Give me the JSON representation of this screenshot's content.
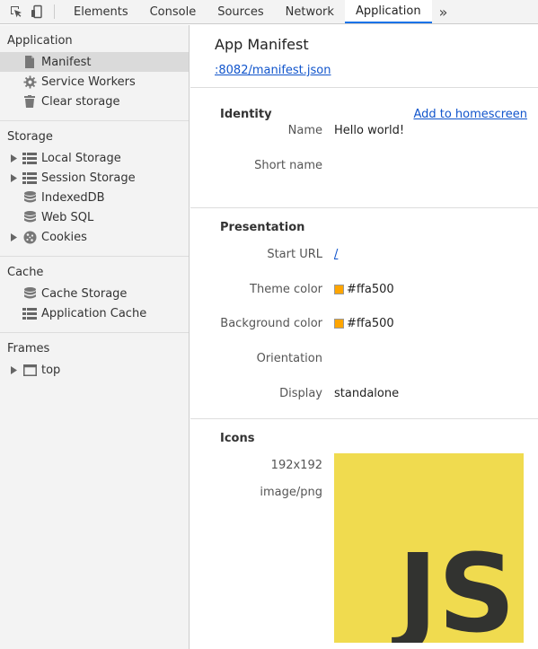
{
  "toolbar": {
    "tabs": [
      {
        "label": "Elements"
      },
      {
        "label": "Console"
      },
      {
        "label": "Sources"
      },
      {
        "label": "Network"
      },
      {
        "label": "Application",
        "active": true
      }
    ],
    "more_label": "»",
    "accent": "#1a73e8"
  },
  "sidebar": {
    "sections": [
      {
        "title": "Application",
        "items": [
          {
            "label": "Manifest",
            "icon": "document-icon",
            "selected": true
          },
          {
            "label": "Service Workers",
            "icon": "gear-icon"
          },
          {
            "label": "Clear storage",
            "icon": "trash-icon"
          }
        ]
      },
      {
        "title": "Storage",
        "items": [
          {
            "label": "Local Storage",
            "icon": "grid-icon",
            "expandable": true
          },
          {
            "label": "Session Storage",
            "icon": "grid-icon",
            "expandable": true
          },
          {
            "label": "IndexedDB",
            "icon": "database-icon"
          },
          {
            "label": "Web SQL",
            "icon": "database-icon"
          },
          {
            "label": "Cookies",
            "icon": "cookie-icon",
            "expandable": true
          }
        ]
      },
      {
        "title": "Cache",
        "items": [
          {
            "label": "Cache Storage",
            "icon": "database-icon"
          },
          {
            "label": "Application Cache",
            "icon": "grid-icon"
          }
        ]
      },
      {
        "title": "Frames",
        "items": [
          {
            "label": "top",
            "icon": "frame-icon",
            "expandable": true
          }
        ]
      }
    ]
  },
  "main": {
    "title": "App Manifest",
    "manifest_link": ":8082/manifest.json",
    "identity": {
      "title": "Identity",
      "action": "Add to homescreen",
      "rows": [
        {
          "key": "Name",
          "value": "Hello world!"
        },
        {
          "key": "Short name",
          "value": ""
        }
      ]
    },
    "presentation": {
      "title": "Presentation",
      "start_url_key": "Start URL",
      "start_url_value": "/",
      "theme_key": "Theme color",
      "theme_value": "#ffa500",
      "bg_key": "Background color",
      "bg_value": "#ffa500",
      "orientation_key": "Orientation",
      "orientation_value": "",
      "display_key": "Display",
      "display_value": "standalone"
    },
    "icons": {
      "title": "Icons",
      "size": "192x192",
      "type": "image/png",
      "logo_text": "JS",
      "logo_bg": "#f0db4f",
      "logo_fg": "#323330"
    }
  }
}
